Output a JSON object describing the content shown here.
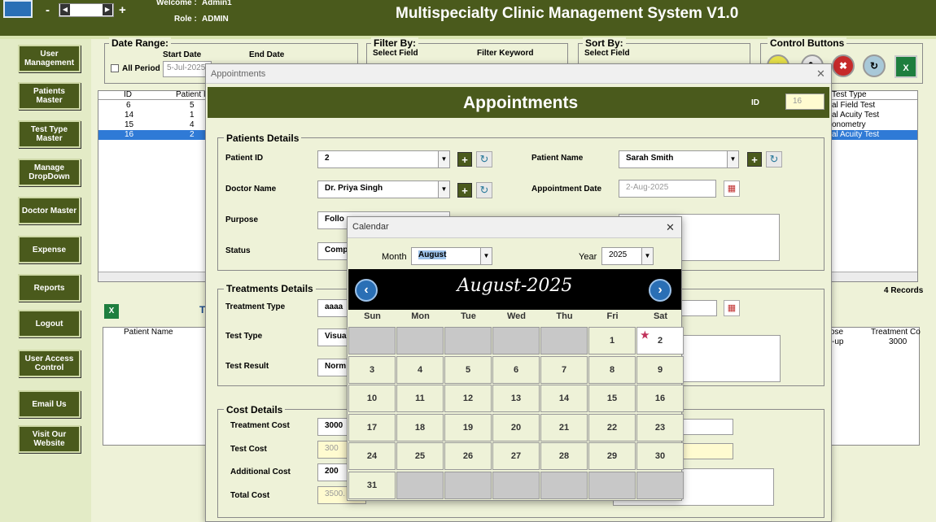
{
  "header": {
    "title": "Multispecialty Clinic Management System V1.0",
    "welcome_label": "Welcome :",
    "welcome_value": "Admin1",
    "role_label": "Role :",
    "role_value": "ADMIN",
    "minus": "-",
    "plus": "+"
  },
  "sidebar": {
    "items": [
      {
        "label": "User Management"
      },
      {
        "label": "Patients Master"
      },
      {
        "label": "Test Type Master"
      },
      {
        "label": "Manage DropDown"
      },
      {
        "label": "Doctor Master"
      },
      {
        "label": "Expense"
      },
      {
        "label": "Reports"
      },
      {
        "label": "Logout"
      },
      {
        "label": "User Access Control"
      },
      {
        "label": "Email Us"
      },
      {
        "label": "Visit Our Website"
      }
    ]
  },
  "filters": {
    "date_range_label": "Date Range:",
    "start_date_label": "Start Date",
    "end_date_label": "End Date",
    "all_period_label": "All Period",
    "start_date_value": "5-Jul-2025",
    "filter_by_label": "Filter By:",
    "select_field_label": "Select Field",
    "filter_keyword_label": "Filter Keyword",
    "sort_by_label": "Sort By:",
    "sort_select_field_label": "Select Field",
    "control_buttons_label": "Control Buttons"
  },
  "grid": {
    "headers": [
      "ID",
      "Patient I"
    ],
    "rows": [
      [
        "6",
        "5"
      ],
      [
        "14",
        "1"
      ],
      [
        "15",
        "4"
      ],
      [
        "16",
        "2"
      ]
    ],
    "right_header": "Test Type",
    "right_rows": [
      "al Field Test",
      "al Acuity Test",
      "onometry",
      "al Acuity Test"
    ],
    "records": "4 Records"
  },
  "lower_grid": {
    "t_label": "T",
    "header_patient": "Patient Name",
    "header_ose": "ose",
    "header_treatment": "Treatment Co",
    "row_ose": "-up",
    "row_treatment": "3000"
  },
  "dialog": {
    "window_title": "Appointments",
    "heading": "Appointments",
    "id_label": "ID",
    "id_value": "16",
    "patients_section": "Patients Details",
    "patient_id_label": "Patient ID",
    "patient_id_value": "2",
    "patient_name_label": "Patient Name",
    "patient_name_value": "Sarah Smith",
    "doctor_name_label": "Doctor Name",
    "doctor_name_value": "Dr. Priya Singh",
    "appointment_date_label": "Appointment Date",
    "appointment_date_value": "2-Aug-2025",
    "purpose_label": "Purpose",
    "purpose_value": "Follo",
    "status_label": "Status",
    "status_value": "Comp",
    "treatments_section": "Treatments Details",
    "treatment_type_label": "Treatment Type",
    "treatment_type_value": "aaaa",
    "test_type_label": "Test Type",
    "test_type_value": "Visua",
    "test_result_label": "Test Result",
    "test_result_value": "Norm",
    "cost_section": "Cost Details",
    "treatment_cost_label": "Treatment Cost",
    "treatment_cost_value": "3000",
    "test_cost_label": "Test Cost",
    "test_cost_value": "300",
    "additional_cost_label": "Additional Cost",
    "additional_cost_value": "200",
    "total_cost_label": "Total Cost",
    "total_cost_value": "3500."
  },
  "calendar": {
    "window_title": "Calendar",
    "month_label": "Month",
    "month_value": "August",
    "year_label": "Year",
    "year_value": "2025",
    "heading": "August-2025",
    "days": [
      "Sun",
      "Mon",
      "Tue",
      "Wed",
      "Thu",
      "Fri",
      "Sat"
    ],
    "weeks": [
      [
        "",
        "",
        "",
        "",
        "",
        "1",
        "2"
      ],
      [
        "3",
        "4",
        "5",
        "6",
        "7",
        "8",
        "9"
      ],
      [
        "10",
        "11",
        "12",
        "13",
        "14",
        "15",
        "16"
      ],
      [
        "17",
        "18",
        "19",
        "20",
        "21",
        "22",
        "23"
      ],
      [
        "24",
        "25",
        "26",
        "27",
        "28",
        "29",
        "30"
      ],
      [
        "31",
        "",
        "",
        "",
        "",
        "",
        ""
      ]
    ],
    "selected_day": "2"
  }
}
